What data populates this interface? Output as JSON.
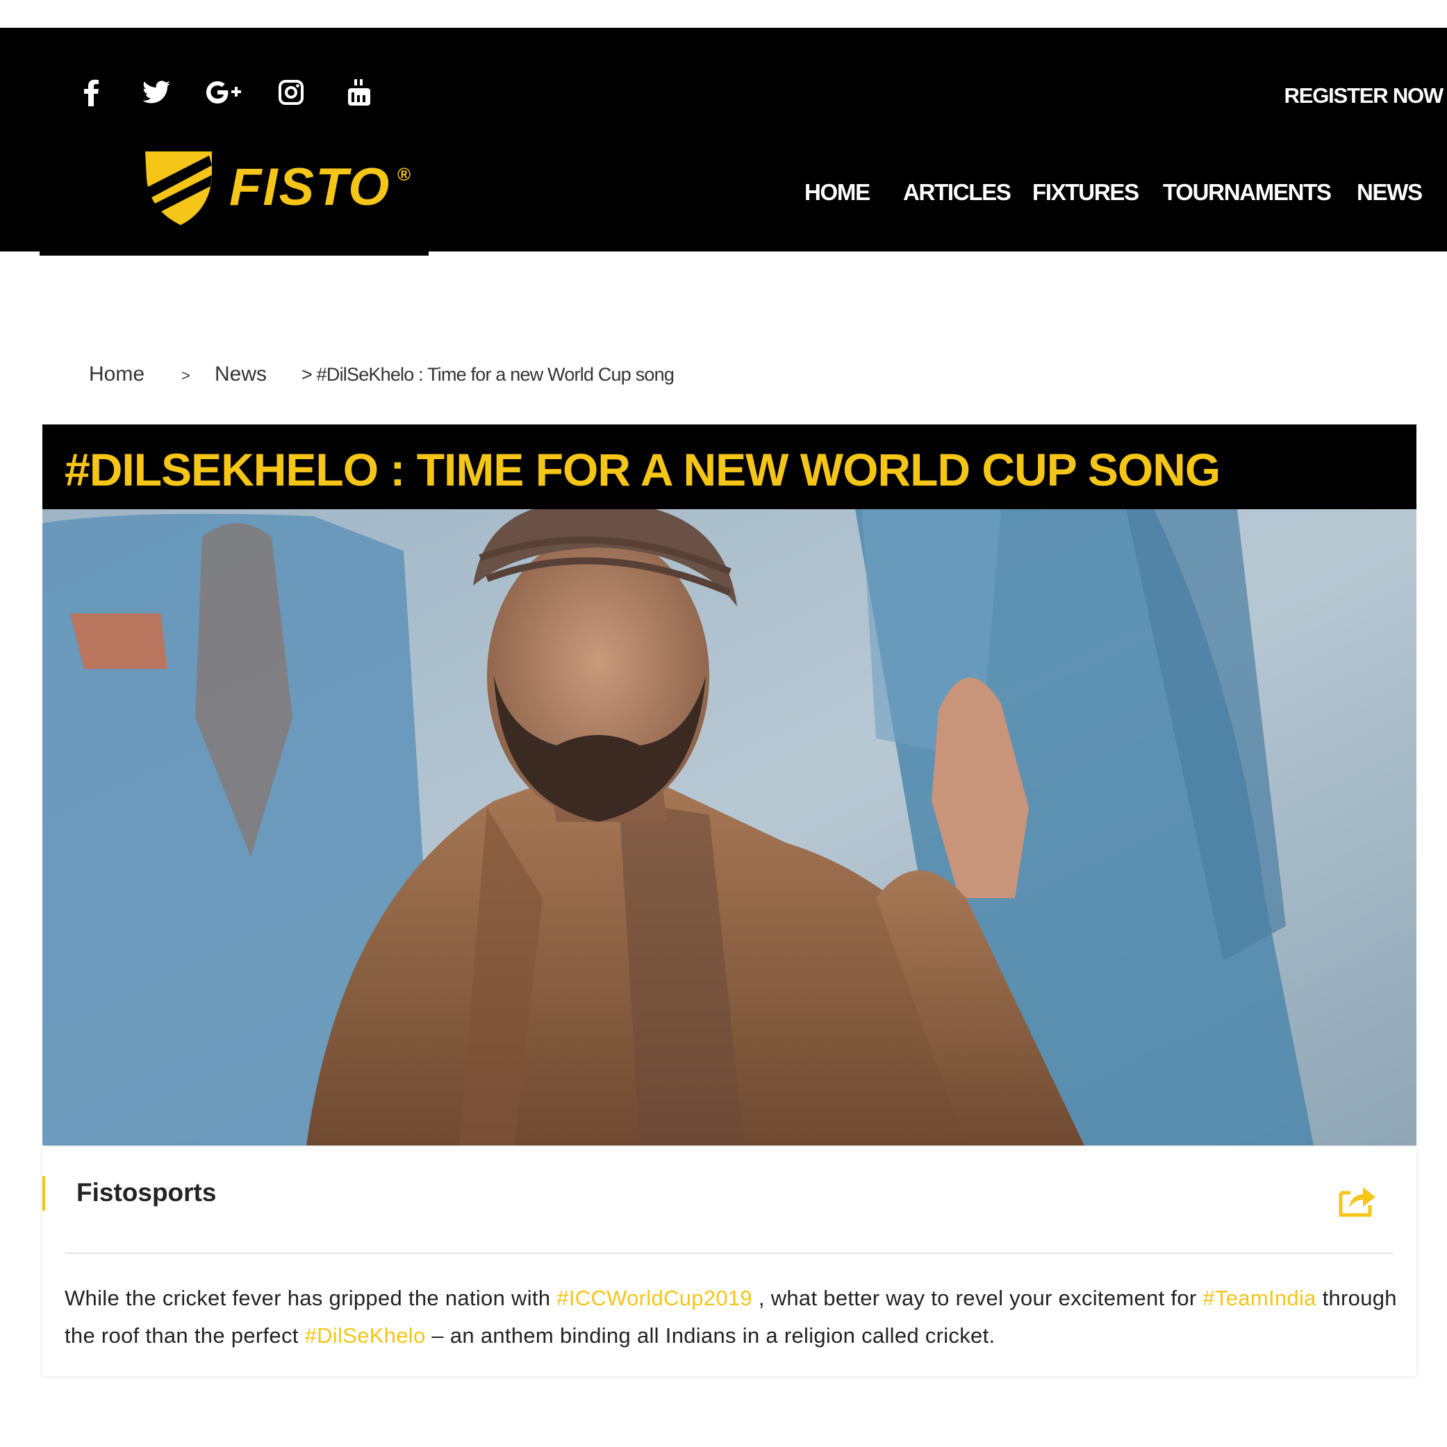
{
  "social": {
    "icons": [
      "facebook-icon",
      "twitter-icon",
      "google-plus-icon",
      "instagram-icon",
      "youtube-icon"
    ]
  },
  "header": {
    "register_label": "REGISTER NOW",
    "logo_text": "FISTO",
    "logo_mark": "®"
  },
  "nav": {
    "home": "HOME",
    "articles": "ARTICLES",
    "fixtures": "FIXTURES",
    "tournaments": "TOURNAMENTS",
    "news": "NEWS"
  },
  "breadcrumb": {
    "home": "Home",
    "sep1": ">",
    "news": "News",
    "current": "> #DilSeKhelo : Time for a new World Cup song"
  },
  "article": {
    "title": "#DILSEKHELO : TIME FOR A NEW WORLD CUP SONG",
    "author": "Fistosports",
    "share_icon": "share-icon",
    "body": {
      "t1": "While the cricket fever has gripped the nation with ",
      "tag1": "#ICCWorldCup2019",
      "t2": " , what better way to revel your excitement for ",
      "tag2": "#TeamIndia",
      "t3": " through the roof than the perfect ",
      "tag3": "#DilSeKhelo",
      "t4": " – an anthem binding all Indians in a religion called cricket."
    }
  },
  "colors": {
    "accent": "#f5c518",
    "header_bg": "#000000",
    "text": "#222222"
  }
}
